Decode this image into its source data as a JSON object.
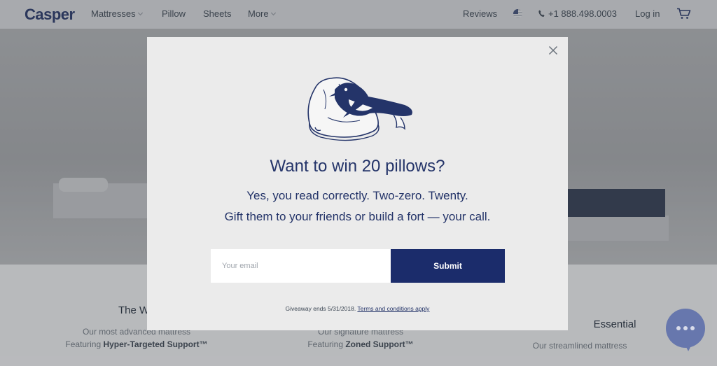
{
  "nav": {
    "logo": "Casper",
    "items": [
      "Mattresses",
      "Pillow",
      "Sheets",
      "More"
    ],
    "reviews": "Reviews",
    "phone": "+1 888.498.0003",
    "login": "Log in"
  },
  "products": [
    {
      "title": "The Wa",
      "line1": "Our most advanced mattress",
      "line2_prefix": "Featuring ",
      "line2_bold": "Hyper-Targeted Support™"
    },
    {
      "title": "",
      "line1": "Our signature mattress",
      "line2_prefix": "Featuring ",
      "line2_bold": "Zoned Support™"
    },
    {
      "title": "Essential",
      "line1": "Our streamlined mattress",
      "line2_prefix": "",
      "line2_bold": ""
    }
  ],
  "modal": {
    "headline": "Want to win 20 pillows?",
    "sub1": "Yes, you read correctly. Two-zero. Twenty.",
    "sub2": "Gift them to your friends or build a fort — your call.",
    "email_placeholder": "Your email",
    "email_value": "",
    "submit_label": "Submit",
    "fine_print": "Giveaway ends 5/31/2018.",
    "terms_link": "Terms and conditions apply"
  },
  "colors": {
    "brand_navy": "#243469",
    "submit_bg": "#1b2c6b",
    "modal_bg": "#ebebeb",
    "chat_bg": "#6777ad"
  },
  "icons": [
    "chevron-down-icon",
    "us-flag-icon",
    "phone-icon",
    "cart-icon",
    "close-icon",
    "sleeping-penguin-illustration",
    "chat-icon"
  ]
}
